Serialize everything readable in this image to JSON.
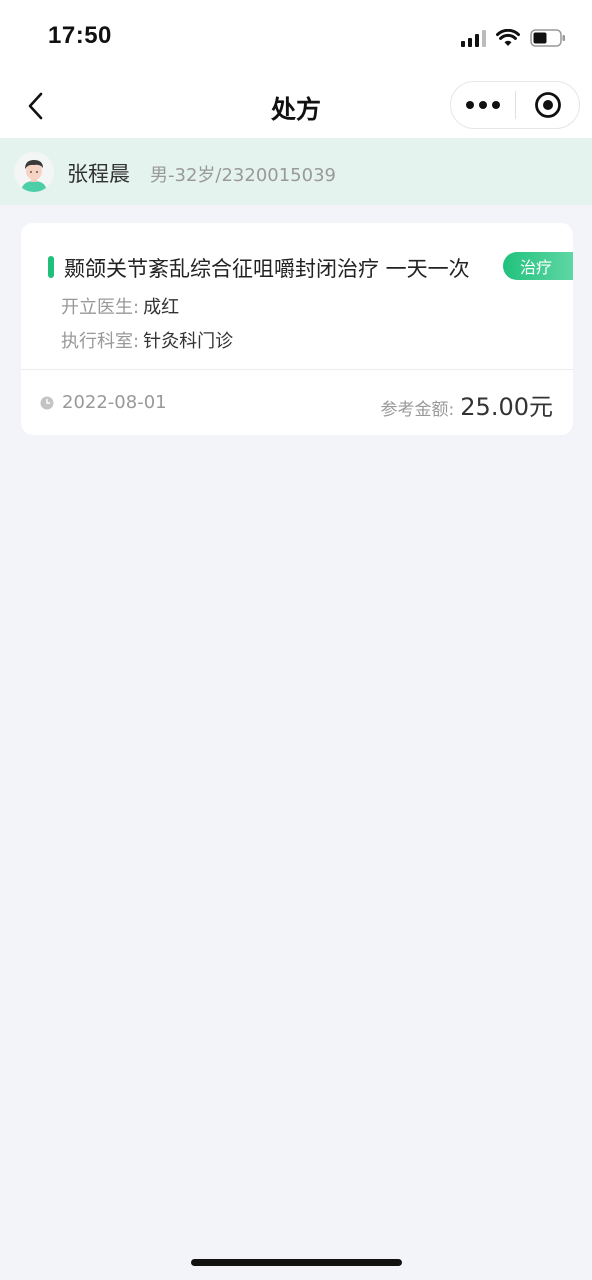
{
  "status_bar": {
    "time": "17:50"
  },
  "nav": {
    "title": "处方",
    "back_icon": "chevron-left-icon",
    "more_icon": "more-dots-icon",
    "close_icon": "target-circle-icon"
  },
  "patient": {
    "name": "张程晨",
    "info": "男-32岁/2320015039"
  },
  "prescription": {
    "title": "颞颌关节紊乱综合征咀嚼封闭治疗 一天一次",
    "tag": "治疗",
    "doctor_label": "开立医生:",
    "doctor_value": "成红",
    "department_label": "执行科室:",
    "department_value": "针灸科门诊",
    "date": "2022-08-01",
    "amount_label": "参考金额:",
    "amount_value": "25.00元"
  },
  "colors": {
    "accent": "#1ec07a",
    "patient_bar_bg": "#e5f3ef",
    "page_bg": "#f3f4f9"
  }
}
